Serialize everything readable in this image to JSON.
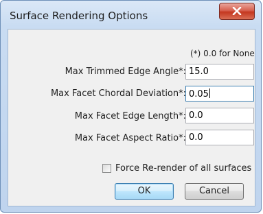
{
  "window": {
    "title": "Surface Rendering Options",
    "close_glyph": "X"
  },
  "form": {
    "hint": "(*) 0.0 for None",
    "fields": [
      {
        "label": "Max Trimmed Edge Angle*:",
        "value": "15.0"
      },
      {
        "label": "Max Facet Chordal Deviation*:",
        "value": "0.05"
      },
      {
        "label": "Max Facet Edge Length*:",
        "value": "0.0"
      },
      {
        "label": "Max Facet Aspect Ratio*:",
        "value": "0.0"
      }
    ],
    "force_checkbox": {
      "label": "Force Re-render of all surfaces",
      "checked": false
    }
  },
  "buttons": {
    "ok": "OK",
    "cancel": "Cancel"
  },
  "colors": {
    "frame": "#c9dcf2",
    "close_button": "#c4371f",
    "client_bg": "#f0f0f0",
    "default_button": "#bee6fd"
  },
  "icons": {
    "close": "close-icon"
  }
}
